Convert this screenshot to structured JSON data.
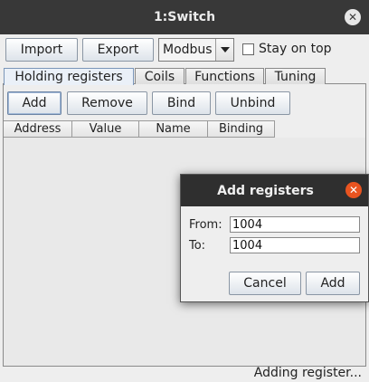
{
  "window": {
    "title": "1:Switch",
    "close_glyph": "✕"
  },
  "toolbar": {
    "import_label": "Import",
    "export_label": "Export",
    "protocol_value": "Modbus",
    "stay_on_top_label": "Stay on top"
  },
  "tabs": [
    {
      "label": "Holding registers",
      "active": true
    },
    {
      "label": "Coils",
      "active": false
    },
    {
      "label": "Functions",
      "active": false
    },
    {
      "label": "Tuning",
      "active": false
    }
  ],
  "register_actions": {
    "add_label": "Add",
    "remove_label": "Remove",
    "bind_label": "Bind",
    "unbind_label": "Unbind"
  },
  "table": {
    "columns": [
      "Address",
      "Value",
      "Name",
      "Binding"
    ],
    "rows": []
  },
  "status": {
    "text": "Adding register..."
  },
  "dialog": {
    "title": "Add registers",
    "close_glyph": "✕",
    "from_label": "From:",
    "from_value": "1004",
    "to_label": "To:",
    "to_value": "1004",
    "cancel_label": "Cancel",
    "add_label": "Add"
  },
  "colors": {
    "title_bar": "#383838",
    "dialog_close_accent": "#e95420",
    "active_tab": "#eaf0f8"
  }
}
